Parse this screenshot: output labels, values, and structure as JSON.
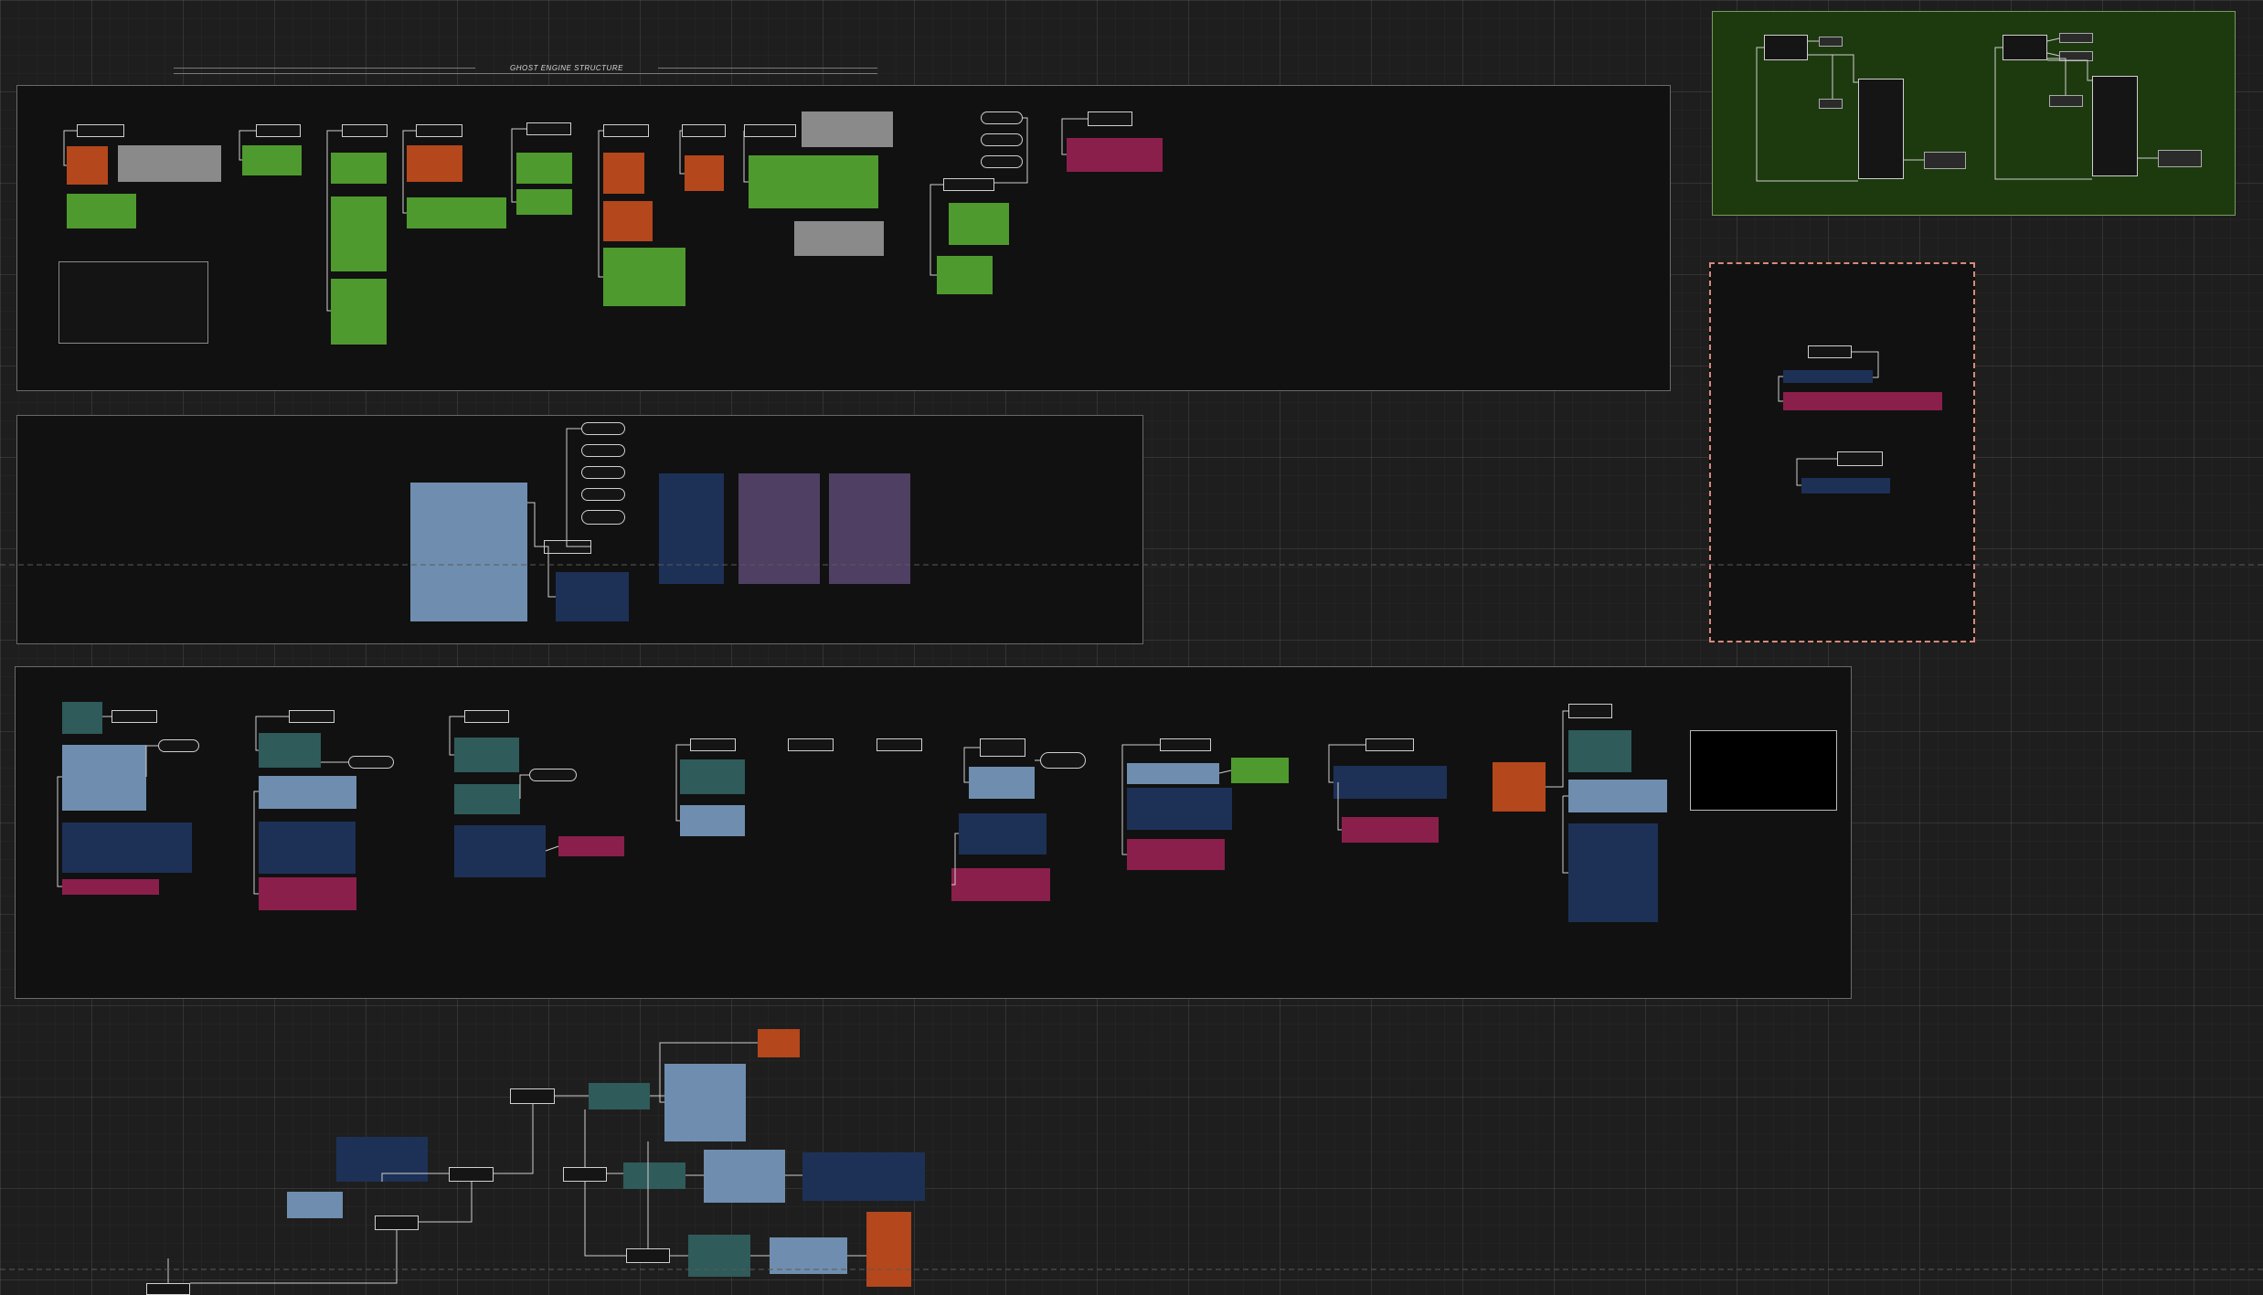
{
  "diagram": {
    "title": "GHOST ENGINE STRUCTURE"
  },
  "colors": {
    "background": "#1e1e1e",
    "frame": "#111111",
    "frame_border": "#6a6a6a",
    "green_frame": "#1d3a0f",
    "dashed_frame_border": "#d98a7a",
    "green": "#4f9a2e",
    "orange": "#b4471c",
    "gray": "#8a8a8a",
    "steel": "#6f8eaf",
    "teal": "#2f5b5a",
    "navy": "#1d3157",
    "magenta": "#8b1f4c",
    "purple": "#4f3f63"
  },
  "nodes": {
    "s1_hdr_01": "",
    "s1_hdr_02": "",
    "s1_hdr_03": "",
    "s1_hdr_04": "",
    "s1_hdr_05": "",
    "s1_hdr_06": "",
    "s1_hdr_07": "",
    "s1_hdr_08": "",
    "s1_hdr_09": "",
    "s1_hdr_10": "",
    "s1_hdr_11": "",
    "s1_hdr_12": "",
    "s1_hdr_13": "",
    "s1_hdr_14": "",
    "s2_pill_01": "",
    "s2_pill_02": "",
    "s2_pill_03": "",
    "s2_pill_04": "",
    "s2_pill_05": "",
    "s2_hdr_01": "",
    "s3_hdr_01": "",
    "s3_hdr_02": "",
    "s3_hdr_03": "",
    "s3_hdr_04": "",
    "s3_hdr_05": "",
    "s3_hdr_06": "",
    "s3_hdr_07": "",
    "s3_hdr_08": "",
    "s3_hdr_09": "",
    "s3_hdr_10": "",
    "s3_hdr_11": "",
    "s3_hdr_12": "",
    "s3_hdr_13": "",
    "s3_hdr_14": "",
    "s3_hdr_15": "",
    "dash_hdr_01": "",
    "dash_hdr_02": "",
    "bot_hdr_01": "",
    "bot_hdr_02": "",
    "bot_hdr_03": "",
    "bot_hdr_04": "",
    "bot_hdr_05": "",
    "bot_hdr_06": "",
    "g_hdr_01": "",
    "g_hdr_02": "",
    "g_hdr_03": "",
    "g_hdr_04": "",
    "g_hdr_05": "",
    "g_hdr_06": "",
    "g_hdr_07": "",
    "g_hdr_08": ""
  }
}
